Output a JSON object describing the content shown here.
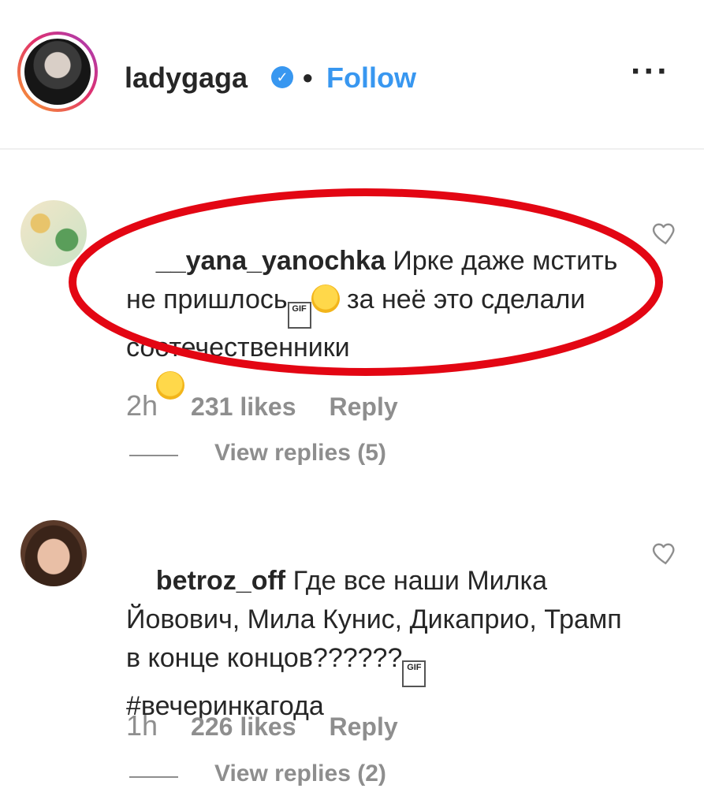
{
  "header": {
    "username": "ladygaga",
    "verified_mark": "✓",
    "separator": "•",
    "follow_label": "Follow",
    "more_label": "···"
  },
  "comments": [
    {
      "username": "__yana_yanochka",
      "text_part1": " Ирке даже мстить не пришлось",
      "text_part2": " за неё это сделали соотечественники",
      "gif_badge": "GIF",
      "time": "2h",
      "likes": "231 likes",
      "reply_label": "Reply",
      "view_replies": "View replies (5)",
      "highlighted": true
    },
    {
      "username": "betroz_off",
      "text_part1": " Где все наши Милка Йовович, Мила Кунис, Дикаприо, Трамп в конце концов??????",
      "text_part2": "#вечеринкагода",
      "gif_badge": "GIF",
      "time": "1h",
      "likes": "226 likes",
      "reply_label": "Reply",
      "view_replies": "View replies (2)"
    }
  ],
  "colors": {
    "link_blue": "#3897f0",
    "muted_gray": "#8e8e8e",
    "highlight_red": "#e30613"
  },
  "icons": [
    "verified-badge-icon",
    "more-options-icon",
    "heart-icon",
    "emoji-icon",
    "gif-icon"
  ]
}
